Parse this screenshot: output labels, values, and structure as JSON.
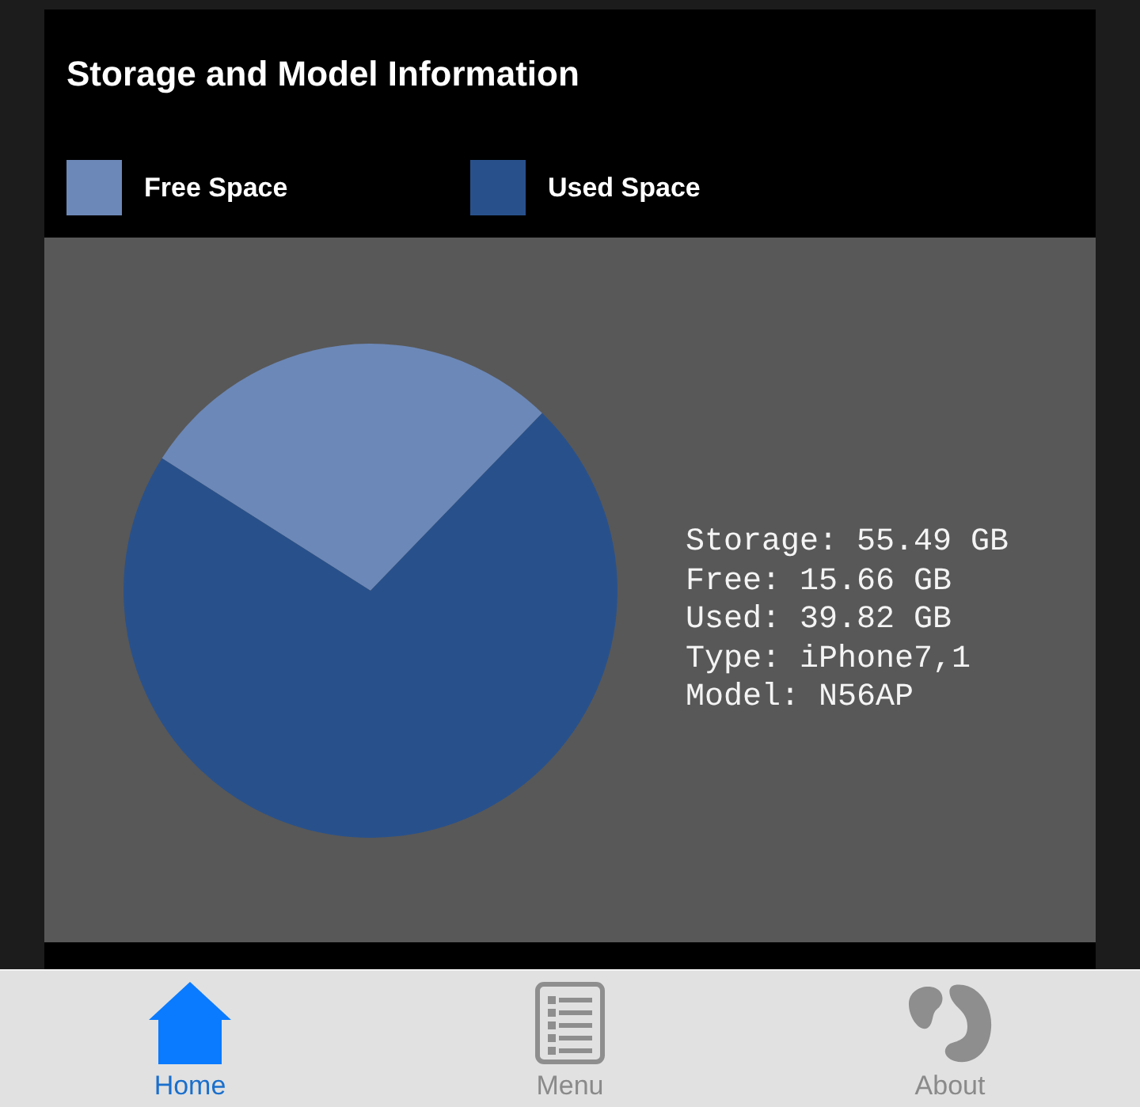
{
  "title": "Storage and Model Information",
  "chart": {
    "legend": [
      {
        "color": "#6c88b8"
      },
      {
        "color": "#28518c"
      }
    ],
    "chart_data": {
      "type": "pie",
      "categories": [
        "Free Space",
        "Used Space"
      ],
      "values": [
        28.23,
        71.77
      ]
    }
  },
  "device_info": {
    "lines": [
      "Storage: 55.49 GB",
      "Free: 15.66 GB",
      "Used: 39.82 GB",
      "Type: iPhone7,1",
      "Model: N56AP"
    ]
  },
  "tab_bar": {
    "tabs": [
      {
        "label": "Home",
        "selected": true
      },
      {
        "label": "Menu",
        "selected": false
      },
      {
        "label": "About",
        "selected": false
      }
    ]
  }
}
